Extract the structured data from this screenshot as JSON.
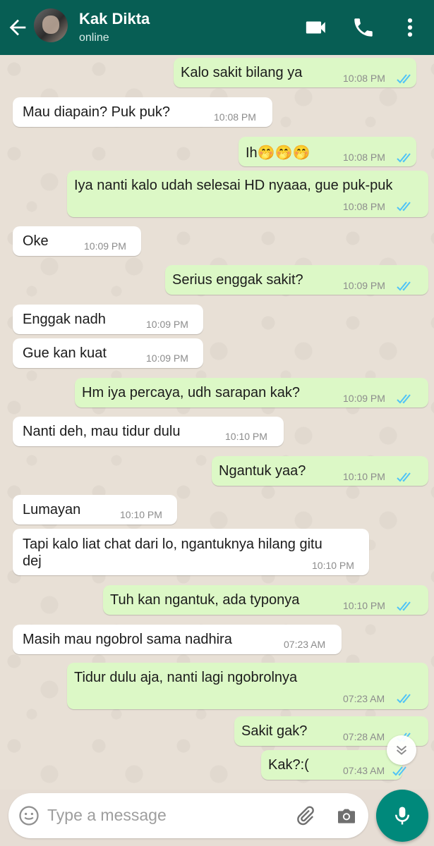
{
  "header": {
    "contact_name": "Kak Dikta",
    "status": "online"
  },
  "icons": {
    "back": "arrow-left-icon",
    "video": "video-call-icon",
    "call": "phone-icon",
    "menu": "more-vert-icon",
    "emoji": "emoji-icon",
    "attach": "paperclip-icon",
    "camera": "camera-icon",
    "mic": "microphone-icon",
    "scroll": "chevron-double-down-icon"
  },
  "colors": {
    "header": "#075e54",
    "outgoing": "#dcf8c6",
    "incoming": "#ffffff",
    "tick": "#4fc3f7",
    "mic_button": "#00897b"
  },
  "messages": [
    {
      "dir": "out",
      "text": "Kalo sakit bilang ya",
      "time": "10:08 PM",
      "read": true
    },
    {
      "dir": "in",
      "text": "Mau diapain? Puk puk?",
      "time": "10:08 PM"
    },
    {
      "dir": "out",
      "text": "Ih🤭🤭🤭",
      "time": "10:08 PM",
      "read": true
    },
    {
      "dir": "out",
      "text": "Iya nanti kalo udah selesai HD nyaaa, gue puk-puk",
      "time": "10:08 PM",
      "read": true
    },
    {
      "dir": "in",
      "text": "Oke",
      "time": "10:09 PM"
    },
    {
      "dir": "out",
      "text": "Serius enggak sakit?",
      "time": "10:09 PM",
      "read": true
    },
    {
      "dir": "in",
      "text": "Enggak nadh",
      "time": "10:09 PM"
    },
    {
      "dir": "in",
      "text": "Gue kan kuat",
      "time": "10:09 PM"
    },
    {
      "dir": "out",
      "text": "Hm iya percaya, udh sarapan kak?",
      "time": "10:09 PM",
      "read": true
    },
    {
      "dir": "in",
      "text": "Nanti deh, mau tidur dulu",
      "time": "10:10 PM"
    },
    {
      "dir": "out",
      "text": "Ngantuk yaa?",
      "time": "10:10 PM",
      "read": true
    },
    {
      "dir": "in",
      "text": "Lumayan",
      "time": "10:10 PM"
    },
    {
      "dir": "in",
      "text": "Tapi kalo liat chat dari lo, ngantuknya hilang gitu\ndej",
      "time": "10:10 PM"
    },
    {
      "dir": "out",
      "text": "Tuh kan ngantuk, ada typonya",
      "time": "10:10 PM",
      "read": true
    },
    {
      "dir": "in",
      "text": "Masih mau ngobrol sama nadhira",
      "time": "07:23 AM"
    },
    {
      "dir": "out",
      "text": "Tidur dulu aja, nanti lagi ngobrolnya",
      "time": "07:23 AM",
      "read": true
    },
    {
      "dir": "out",
      "text": "Sakit gak?",
      "time": "07:28 AM",
      "read": true
    },
    {
      "dir": "out",
      "text": "Kak?:(",
      "time": "07:43 AM",
      "read": true
    }
  ],
  "composer": {
    "placeholder": "Type a message"
  }
}
